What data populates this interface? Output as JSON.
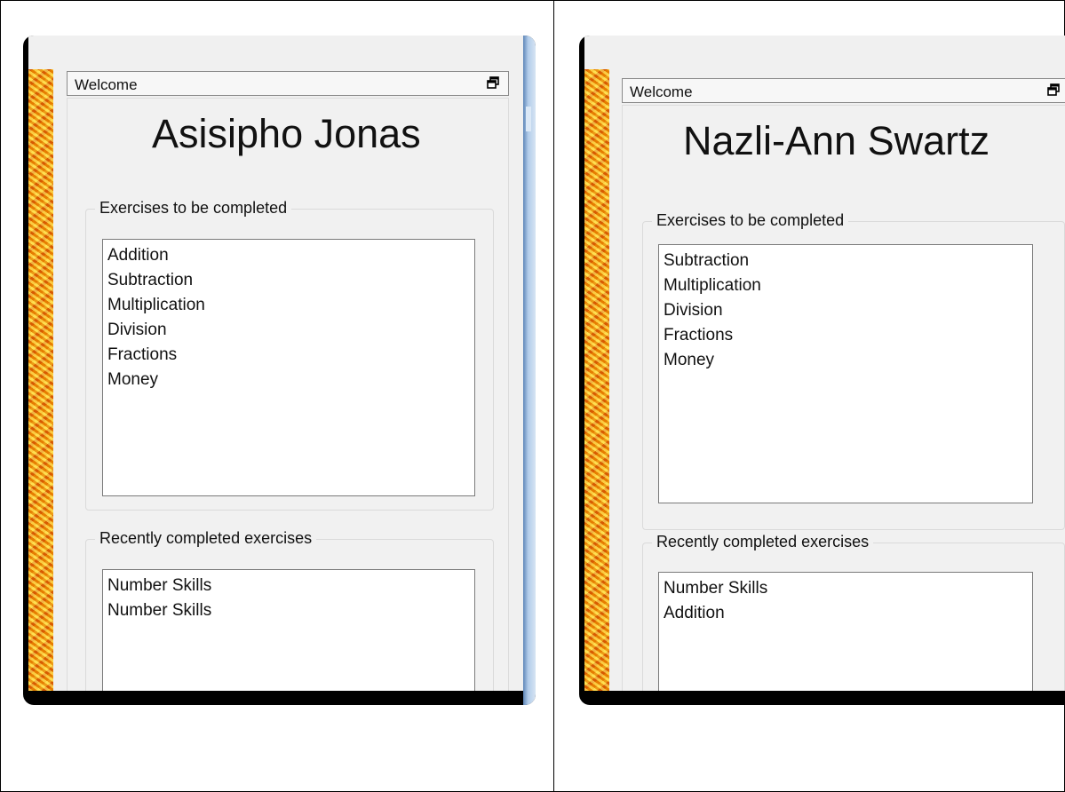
{
  "left_window": {
    "panel_title": "Welcome",
    "student_name": "Asisipho  Jonas",
    "exercises_group_label": "Exercises to be completed",
    "exercises": [
      "Addition",
      "Subtraction",
      "Multiplication",
      "Division",
      "Fractions",
      "Money"
    ],
    "recent_group_label": "Recently completed exercises",
    "recent": [
      "Number Skills",
      "Number Skills"
    ]
  },
  "right_window": {
    "panel_title": "Welcome",
    "student_name": "Nazli-Ann Swartz",
    "exercises_group_label": "Exercises to be completed",
    "exercises": [
      "Subtraction",
      "Multiplication",
      "Division",
      "Fractions",
      "Money"
    ],
    "recent_group_label": "Recently completed exercises",
    "recent": [
      "Number Skills",
      "Addition"
    ]
  },
  "icons": {
    "restore": "restore-window-icon",
    "decorative_strip": "orange-texture-strip"
  },
  "colors": {
    "frame": "#000000",
    "panel_bg": "#f0f0f0",
    "sidebar_blue": "#b3cdea",
    "strip_orange": "#f6a000"
  }
}
